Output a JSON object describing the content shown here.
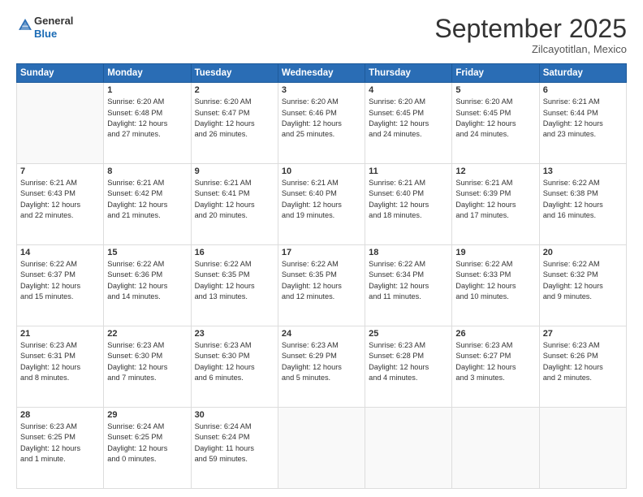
{
  "logo": {
    "general": "General",
    "blue": "Blue"
  },
  "header": {
    "month": "September 2025",
    "location": "Zilcayotitlan, Mexico"
  },
  "weekdays": [
    "Sunday",
    "Monday",
    "Tuesday",
    "Wednesday",
    "Thursday",
    "Friday",
    "Saturday"
  ],
  "weeks": [
    [
      {
        "day": "",
        "info": ""
      },
      {
        "day": "1",
        "info": "Sunrise: 6:20 AM\nSunset: 6:48 PM\nDaylight: 12 hours\nand 27 minutes."
      },
      {
        "day": "2",
        "info": "Sunrise: 6:20 AM\nSunset: 6:47 PM\nDaylight: 12 hours\nand 26 minutes."
      },
      {
        "day": "3",
        "info": "Sunrise: 6:20 AM\nSunset: 6:46 PM\nDaylight: 12 hours\nand 25 minutes."
      },
      {
        "day": "4",
        "info": "Sunrise: 6:20 AM\nSunset: 6:45 PM\nDaylight: 12 hours\nand 24 minutes."
      },
      {
        "day": "5",
        "info": "Sunrise: 6:20 AM\nSunset: 6:45 PM\nDaylight: 12 hours\nand 24 minutes."
      },
      {
        "day": "6",
        "info": "Sunrise: 6:21 AM\nSunset: 6:44 PM\nDaylight: 12 hours\nand 23 minutes."
      }
    ],
    [
      {
        "day": "7",
        "info": "Sunrise: 6:21 AM\nSunset: 6:43 PM\nDaylight: 12 hours\nand 22 minutes."
      },
      {
        "day": "8",
        "info": "Sunrise: 6:21 AM\nSunset: 6:42 PM\nDaylight: 12 hours\nand 21 minutes."
      },
      {
        "day": "9",
        "info": "Sunrise: 6:21 AM\nSunset: 6:41 PM\nDaylight: 12 hours\nand 20 minutes."
      },
      {
        "day": "10",
        "info": "Sunrise: 6:21 AM\nSunset: 6:40 PM\nDaylight: 12 hours\nand 19 minutes."
      },
      {
        "day": "11",
        "info": "Sunrise: 6:21 AM\nSunset: 6:40 PM\nDaylight: 12 hours\nand 18 minutes."
      },
      {
        "day": "12",
        "info": "Sunrise: 6:21 AM\nSunset: 6:39 PM\nDaylight: 12 hours\nand 17 minutes."
      },
      {
        "day": "13",
        "info": "Sunrise: 6:22 AM\nSunset: 6:38 PM\nDaylight: 12 hours\nand 16 minutes."
      }
    ],
    [
      {
        "day": "14",
        "info": "Sunrise: 6:22 AM\nSunset: 6:37 PM\nDaylight: 12 hours\nand 15 minutes."
      },
      {
        "day": "15",
        "info": "Sunrise: 6:22 AM\nSunset: 6:36 PM\nDaylight: 12 hours\nand 14 minutes."
      },
      {
        "day": "16",
        "info": "Sunrise: 6:22 AM\nSunset: 6:35 PM\nDaylight: 12 hours\nand 13 minutes."
      },
      {
        "day": "17",
        "info": "Sunrise: 6:22 AM\nSunset: 6:35 PM\nDaylight: 12 hours\nand 12 minutes."
      },
      {
        "day": "18",
        "info": "Sunrise: 6:22 AM\nSunset: 6:34 PM\nDaylight: 12 hours\nand 11 minutes."
      },
      {
        "day": "19",
        "info": "Sunrise: 6:22 AM\nSunset: 6:33 PM\nDaylight: 12 hours\nand 10 minutes."
      },
      {
        "day": "20",
        "info": "Sunrise: 6:22 AM\nSunset: 6:32 PM\nDaylight: 12 hours\nand 9 minutes."
      }
    ],
    [
      {
        "day": "21",
        "info": "Sunrise: 6:23 AM\nSunset: 6:31 PM\nDaylight: 12 hours\nand 8 minutes."
      },
      {
        "day": "22",
        "info": "Sunrise: 6:23 AM\nSunset: 6:30 PM\nDaylight: 12 hours\nand 7 minutes."
      },
      {
        "day": "23",
        "info": "Sunrise: 6:23 AM\nSunset: 6:30 PM\nDaylight: 12 hours\nand 6 minutes."
      },
      {
        "day": "24",
        "info": "Sunrise: 6:23 AM\nSunset: 6:29 PM\nDaylight: 12 hours\nand 5 minutes."
      },
      {
        "day": "25",
        "info": "Sunrise: 6:23 AM\nSunset: 6:28 PM\nDaylight: 12 hours\nand 4 minutes."
      },
      {
        "day": "26",
        "info": "Sunrise: 6:23 AM\nSunset: 6:27 PM\nDaylight: 12 hours\nand 3 minutes."
      },
      {
        "day": "27",
        "info": "Sunrise: 6:23 AM\nSunset: 6:26 PM\nDaylight: 12 hours\nand 2 minutes."
      }
    ],
    [
      {
        "day": "28",
        "info": "Sunrise: 6:23 AM\nSunset: 6:25 PM\nDaylight: 12 hours\nand 1 minute."
      },
      {
        "day": "29",
        "info": "Sunrise: 6:24 AM\nSunset: 6:25 PM\nDaylight: 12 hours\nand 0 minutes."
      },
      {
        "day": "30",
        "info": "Sunrise: 6:24 AM\nSunset: 6:24 PM\nDaylight: 11 hours\nand 59 minutes."
      },
      {
        "day": "",
        "info": ""
      },
      {
        "day": "",
        "info": ""
      },
      {
        "day": "",
        "info": ""
      },
      {
        "day": "",
        "info": ""
      }
    ]
  ]
}
